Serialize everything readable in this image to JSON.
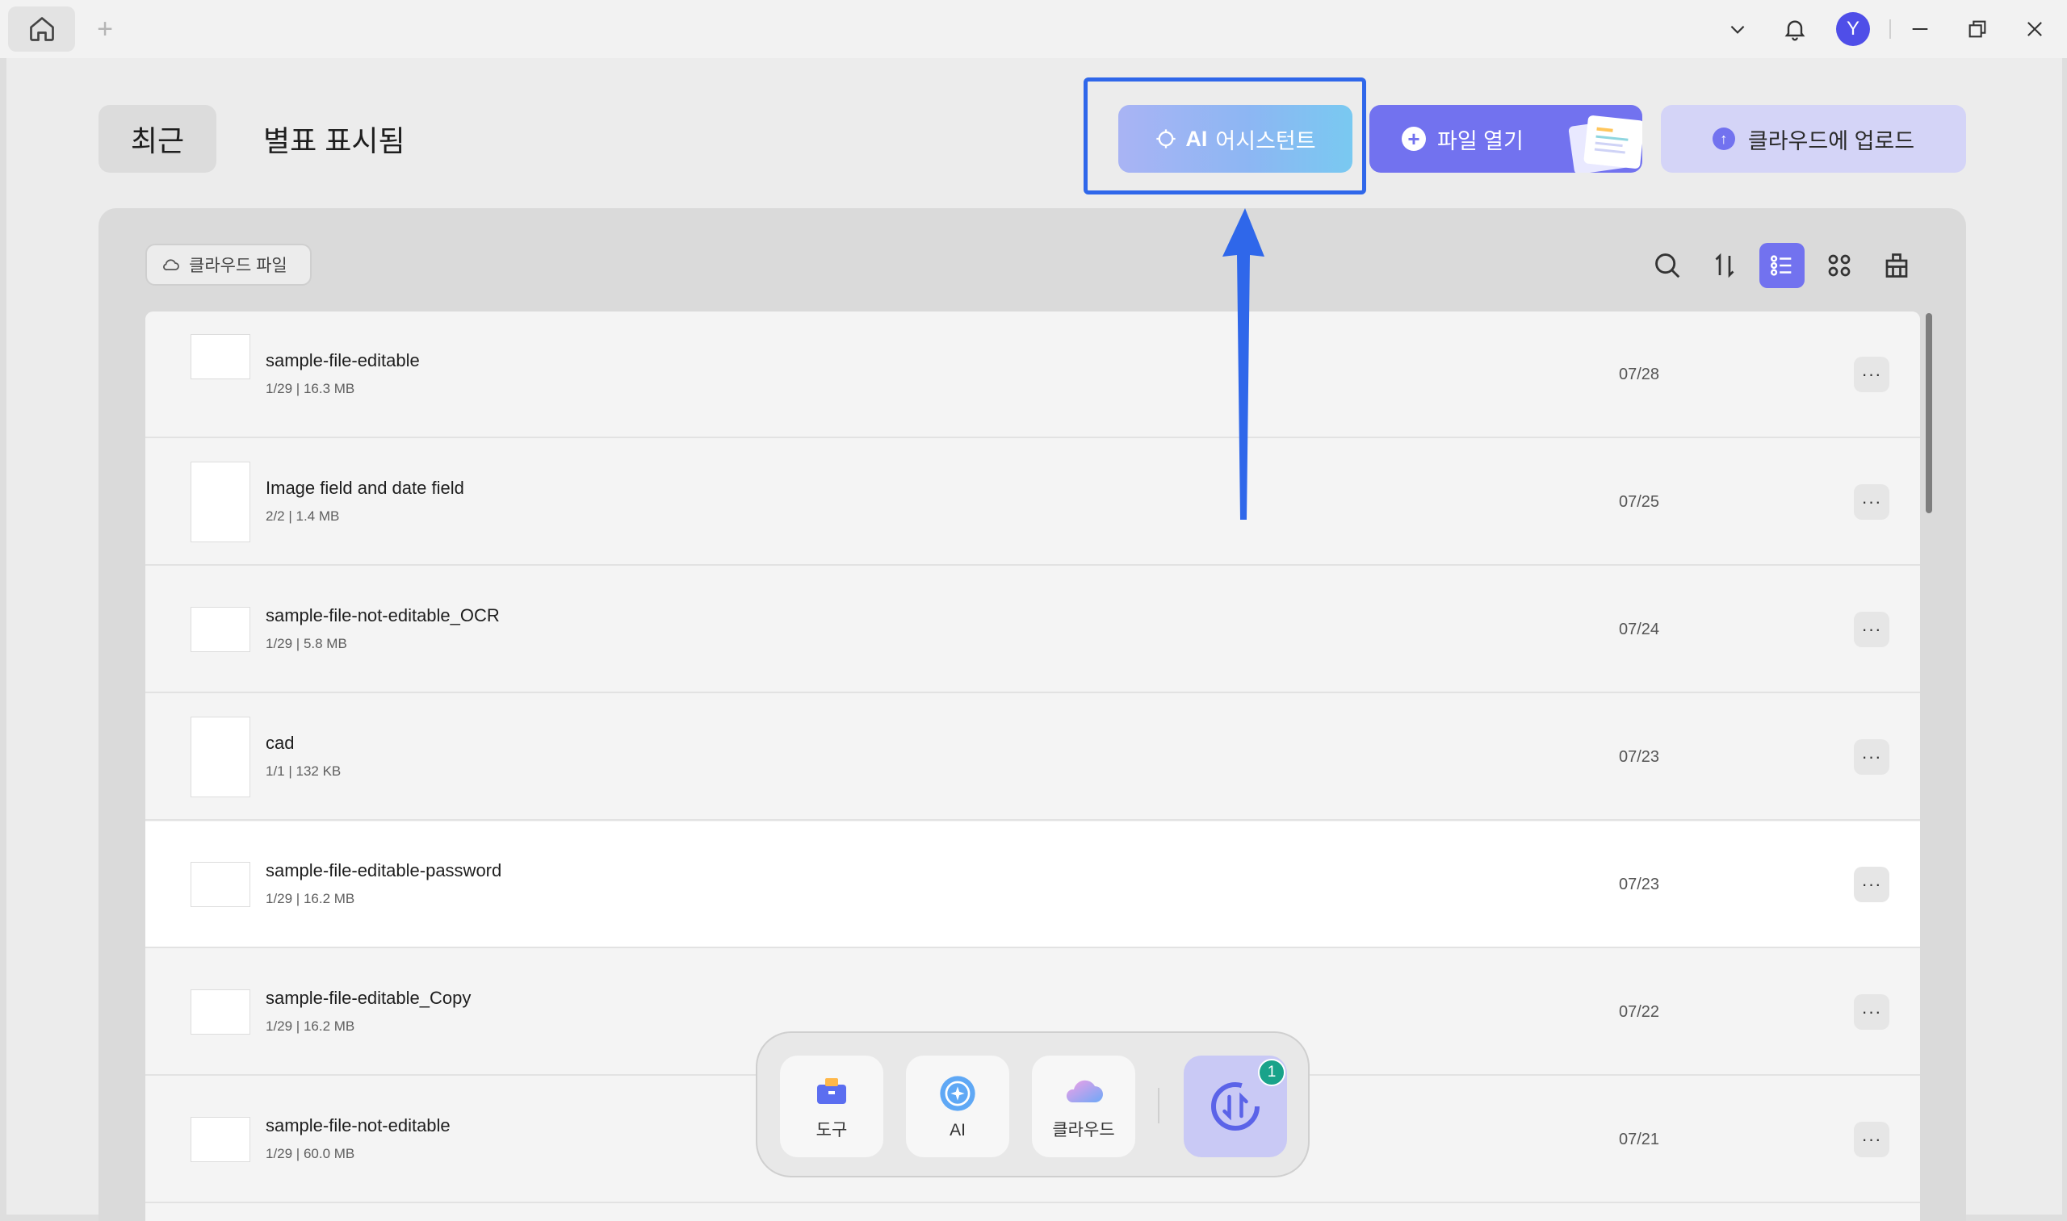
{
  "titlebar": {
    "avatar_letter": "Y",
    "new_tab_symbol": "+"
  },
  "header": {
    "tab_recent": "최근",
    "tab_starred": "별표 표시됨",
    "ai_button": {
      "prefix": "AI",
      "label": "어시스턴트"
    },
    "open_button": "파일 열기",
    "upload_button": "클라우드에 업로드"
  },
  "toolbar": {
    "cloud_files": "클라우드 파일"
  },
  "files": [
    {
      "name": "sample-file-editable",
      "meta": "1/29 | 16.3 MB",
      "date": "07/28"
    },
    {
      "name": "Image field and date field",
      "meta": "2/2 | 1.4 MB",
      "date": "07/25"
    },
    {
      "name": "sample-file-not-editable_OCR",
      "meta": "1/29 | 5.8 MB",
      "date": "07/24"
    },
    {
      "name": "cad",
      "meta": "1/1 | 132 KB",
      "date": "07/23"
    },
    {
      "name": "sample-file-editable-password",
      "meta": "1/29 | 16.2 MB",
      "date": "07/23"
    },
    {
      "name": "sample-file-editable_Copy",
      "meta": "1/29 | 16.2 MB",
      "date": "07/22"
    },
    {
      "name": "sample-file-not-editable",
      "meta": "1/29 | 60.0 MB",
      "date": "07/21"
    }
  ],
  "more_symbol": "···",
  "dock": {
    "tools": "도구",
    "ai": "AI",
    "cloud": "클라우드",
    "badge_count": "1"
  },
  "colors": {
    "accent": "#7272ef",
    "highlight": "#2f67ea",
    "badge": "#19a38a"
  }
}
